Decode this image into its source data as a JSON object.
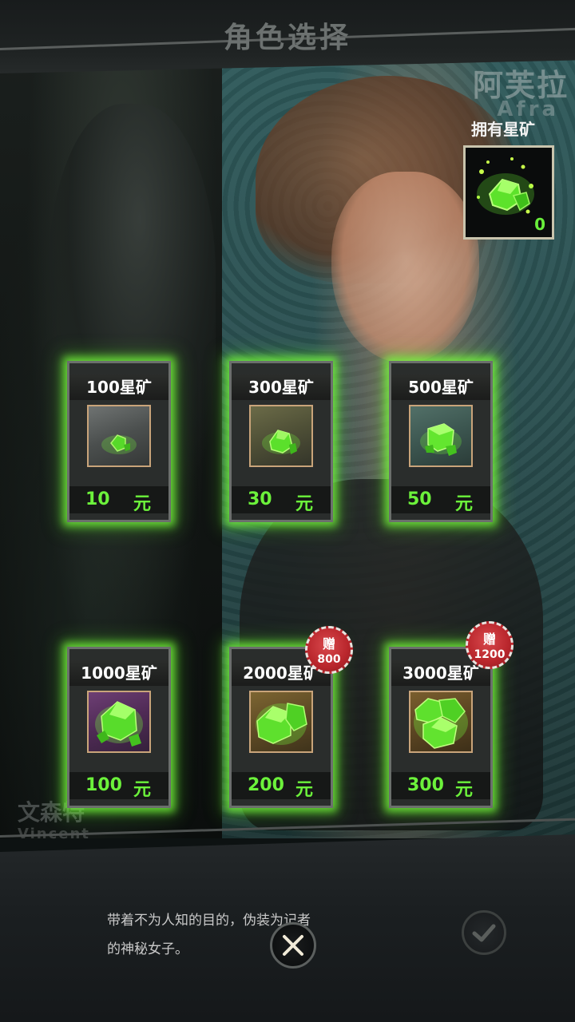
{
  "header": {
    "title": "角色选择"
  },
  "characters": {
    "current": {
      "name_cn": "阿芙拉",
      "name_en": "Afra"
    },
    "other": {
      "name_cn": "文森特",
      "name_en": "Vincent"
    }
  },
  "owned": {
    "label": "拥有星矿",
    "count": "0",
    "icon": "green-ore-icon"
  },
  "products": [
    {
      "title": "100星矿",
      "price": "10",
      "unit": "元",
      "theme": "gray"
    },
    {
      "title": "300星矿",
      "price": "30",
      "unit": "元",
      "theme": "olive"
    },
    {
      "title": "500星矿",
      "price": "50",
      "unit": "元",
      "theme": "teal"
    },
    {
      "title": "1000星矿",
      "price": "100",
      "unit": "元",
      "theme": "purple"
    },
    {
      "title": "2000星矿",
      "price": "200",
      "unit": "元",
      "theme": "gold",
      "gift": {
        "label": "赠",
        "amount": "800"
      }
    },
    {
      "title": "3000星矿",
      "price": "300",
      "unit": "元",
      "theme": "amber",
      "gift": {
        "label": "赠",
        "amount": "1200"
      }
    }
  ],
  "description": {
    "line1": "带着不为人知的目的，伪装为记者",
    "line2": "的神秘女子。"
  },
  "colors": {
    "accent_green": "#6cf23b",
    "glow": "#7cff3c",
    "badge_red": "#c0282e"
  }
}
